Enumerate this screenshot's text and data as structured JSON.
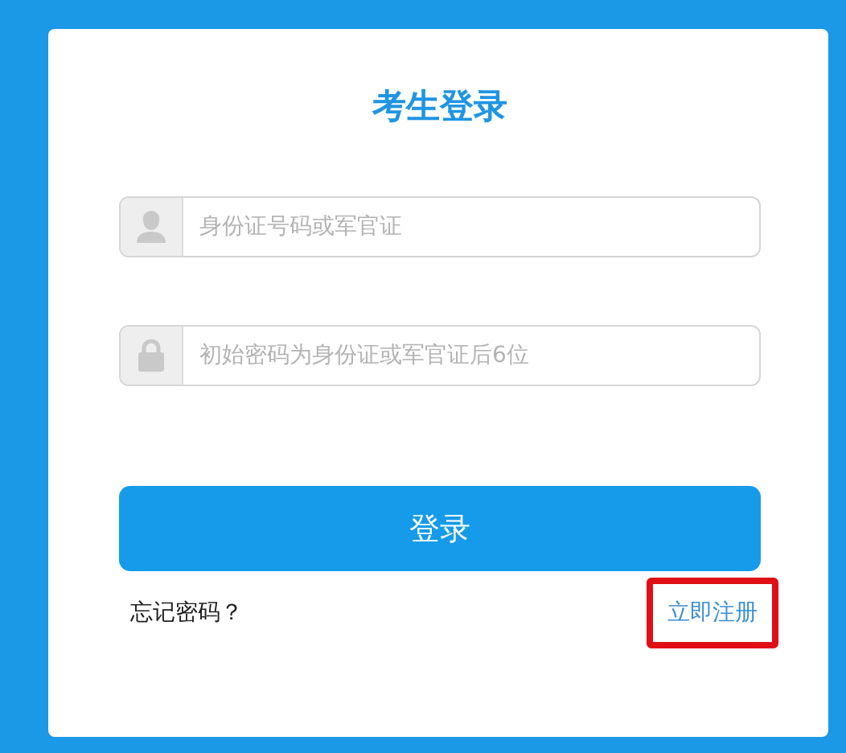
{
  "title": "考生登录",
  "fields": [
    {
      "kind": "user",
      "placeholder": "身份证号码或军官证"
    },
    {
      "kind": "lock",
      "placeholder": "初始密码为身份证或军官证后6位"
    }
  ],
  "login_button": "登录",
  "forgot_link": "忘记密码？",
  "register_link": {
    "label": "立即注册",
    "highlighted": true
  }
}
